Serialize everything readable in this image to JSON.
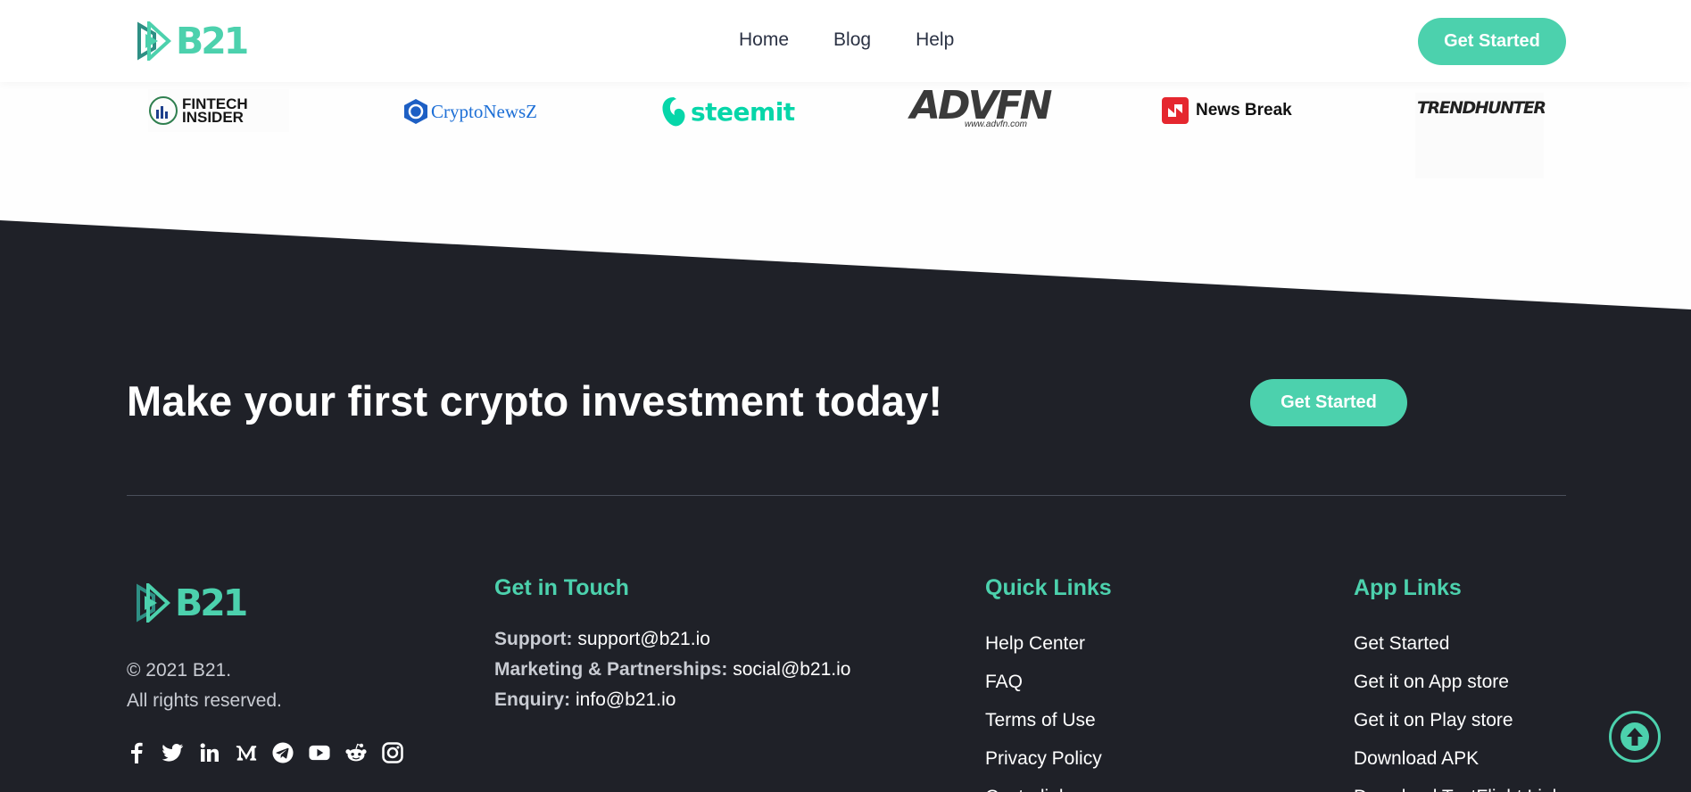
{
  "header": {
    "logo_text": "B21",
    "nav": [
      "Home",
      "Blog",
      "Help"
    ],
    "cta_label": "Get Started"
  },
  "press": {
    "fintech": [
      "FINTECH",
      "INSIDER"
    ],
    "cryptonewsz": "CryptoNewsZ",
    "steemit": "steemit",
    "advfn": "ADVFN",
    "advfn_url": "www.advfn.com",
    "newsbreak": "News Break",
    "trendhunter": "TRENDHUNTER"
  },
  "cta": {
    "title": "Make your first crypto investment today!",
    "button": "Get Started"
  },
  "footer": {
    "logo_text": "B21",
    "copyright": "© 2021 B21.",
    "rights": "All rights reserved.",
    "socials": [
      "facebook-icon",
      "twitter-icon",
      "linkedin-icon",
      "medium-icon",
      "telegram-icon",
      "youtube-icon",
      "reddit-icon",
      "instagram-icon"
    ],
    "touch": {
      "title": "Get in Touch",
      "support_label": "Support:",
      "support_value": "support@b21.io",
      "marketing_label": "Marketing & Partnerships:",
      "marketing_value": "social@b21.io",
      "enquiry_label": "Enquiry:",
      "enquiry_value": "info@b21.io"
    },
    "quick_links": {
      "title": "Quick Links",
      "items": [
        "Help Center",
        "FAQ",
        "Terms of Use",
        "Privacy Policy",
        "Custodial"
      ]
    },
    "app_links": {
      "title": "App Links",
      "items": [
        "Get Started",
        "Get it on App store",
        "Get it on Play store",
        "Download APK",
        "Download TestFlight Link"
      ]
    }
  },
  "colors": {
    "accent": "#4cd1ad",
    "dark": "#1f2128",
    "text_dark": "#2b3244"
  }
}
